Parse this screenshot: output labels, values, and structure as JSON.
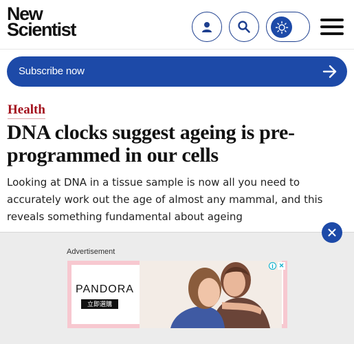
{
  "header": {
    "logo_line1": "New",
    "logo_line2": "Scientist",
    "account_icon": "person-icon",
    "search_icon": "search-icon",
    "theme_icon": "sun-icon",
    "menu_icon": "hamburger-menu-icon"
  },
  "subscribe": {
    "label": "Subscribe now",
    "icon": "arrow-right-icon"
  },
  "article": {
    "category": "Health",
    "headline": "DNA clocks suggest ageing is pre-programmed in our cells",
    "standfirst": "Looking at DNA in a tissue sample is now all you need to accurately work out the age of almost any mammal, and this reveals something fundamental about ageing"
  },
  "ad": {
    "label": "Advertisement",
    "brand": "PANDORA",
    "cta": "立即選購",
    "close_icon": "close-icon"
  },
  "colors": {
    "brand_blue": "#1d4aa8",
    "category_red": "#a3101c",
    "ad_pink": "#f7c8d0"
  }
}
